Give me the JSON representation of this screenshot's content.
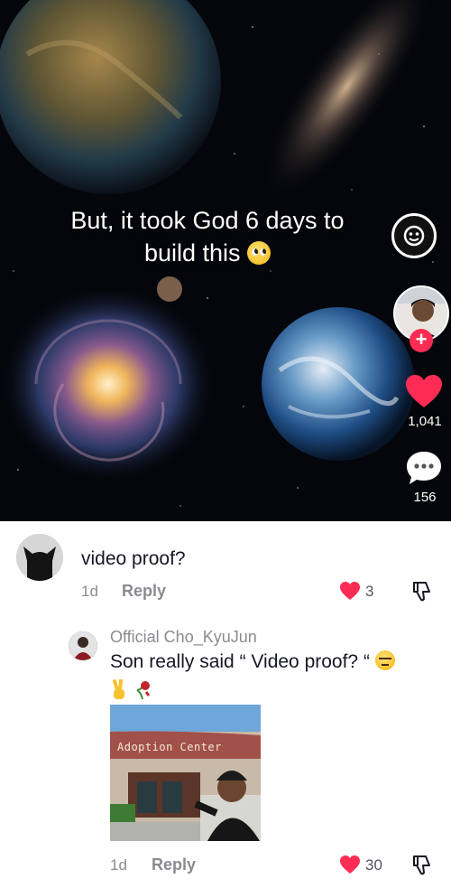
{
  "video": {
    "caption_line1": "But, it took God 6 days to",
    "caption_line2": "build this",
    "like_count": "1,041",
    "comment_count": "156",
    "icons": [
      "scan-icon",
      "avatar",
      "follow-plus-icon",
      "heart-icon",
      "comment-icon"
    ],
    "colors": {
      "accent": "#fe2c55",
      "background": "#04060b"
    }
  },
  "comments": [
    {
      "text": "video proof?",
      "time": "1d",
      "reply_label": "Reply",
      "likes": "3"
    },
    {
      "username": "Official Cho_KyuJun",
      "text": "Son really said “ Video proof? “",
      "time": "1d",
      "reply_label": "Reply",
      "likes": "30",
      "image_sign": "Adoption Center"
    }
  ]
}
